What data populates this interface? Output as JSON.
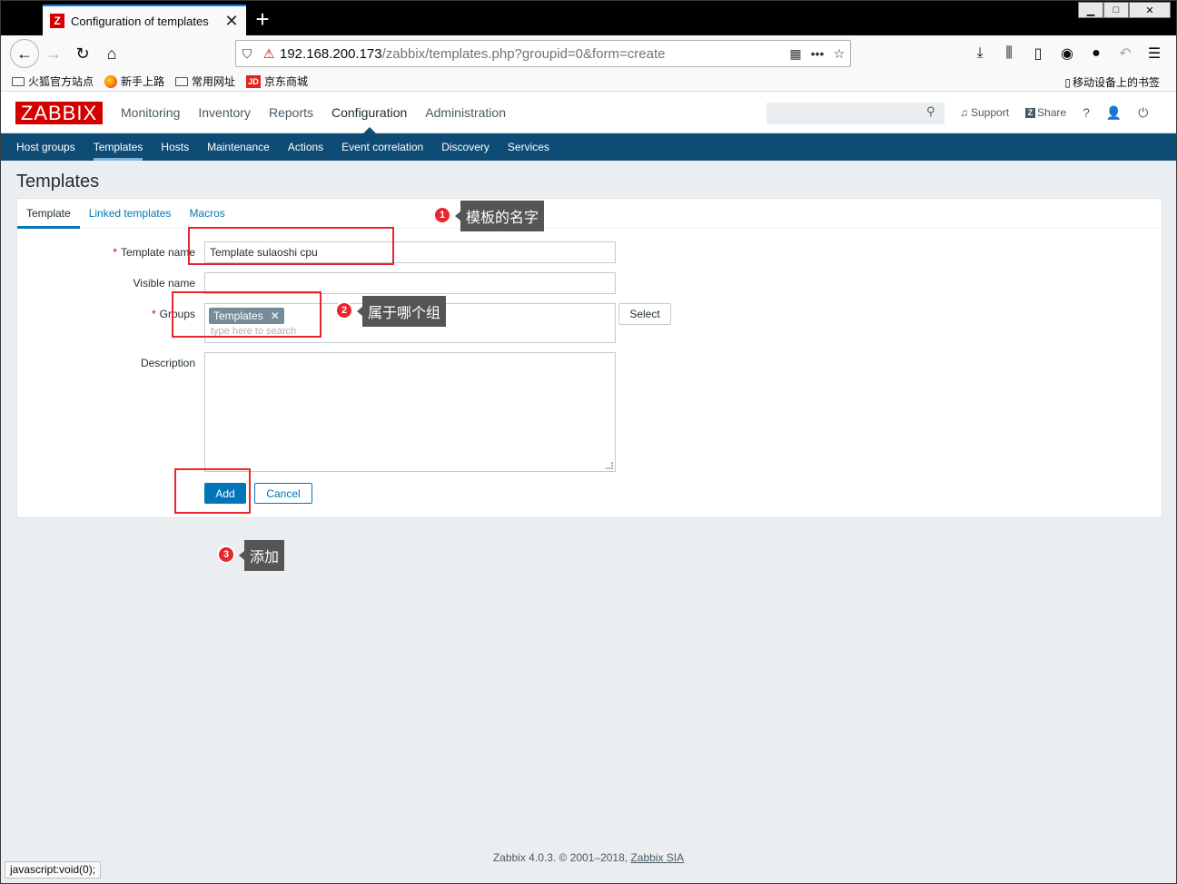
{
  "browser": {
    "tab_title": "Configuration of templates",
    "tab_favicon": "Z",
    "url_host": "192.168.200.173",
    "url_path": "/zabbix/templates.php?groupid=0&form=create",
    "bookmarks": [
      "火狐官方站点",
      "新手上路",
      "常用网址",
      "京东商城"
    ],
    "mobile_bookmarks": "移动设备上的书签",
    "status_text": "javascript:void(0);"
  },
  "header": {
    "logo": "ZABBIX",
    "main_menu": [
      "Monitoring",
      "Inventory",
      "Reports",
      "Configuration",
      "Administration"
    ],
    "active_main": "Configuration",
    "support": "Support",
    "share": "Share",
    "help": "?"
  },
  "sub_menu": [
    "Host groups",
    "Templates",
    "Hosts",
    "Maintenance",
    "Actions",
    "Event correlation",
    "Discovery",
    "Services"
  ],
  "page_title": "Templates",
  "form": {
    "tabs": [
      "Template",
      "Linked templates",
      "Macros"
    ],
    "template_name_label": "Template name",
    "template_name_value": "Template sulaoshi cpu",
    "visible_name_label": "Visible name",
    "visible_name_value": "",
    "groups_label": "Groups",
    "group_tag": "Templates",
    "groups_placeholder": "type here to search",
    "select_button": "Select",
    "description_label": "Description",
    "add_button": "Add",
    "cancel_button": "Cancel"
  },
  "annotations": [
    {
      "number": "1",
      "text": "模板的名字"
    },
    {
      "number": "2",
      "text": "属于哪个组"
    },
    {
      "number": "3",
      "text": "添加"
    }
  ],
  "footer": {
    "text": "Zabbix 4.0.3. © 2001–2018, ",
    "link": "Zabbix SIA"
  },
  "colors": {
    "brand_red": "#d40000",
    "submenu_blue": "#0f4c75",
    "link_blue": "#0275b8",
    "annotation_red": "#e8262b"
  }
}
